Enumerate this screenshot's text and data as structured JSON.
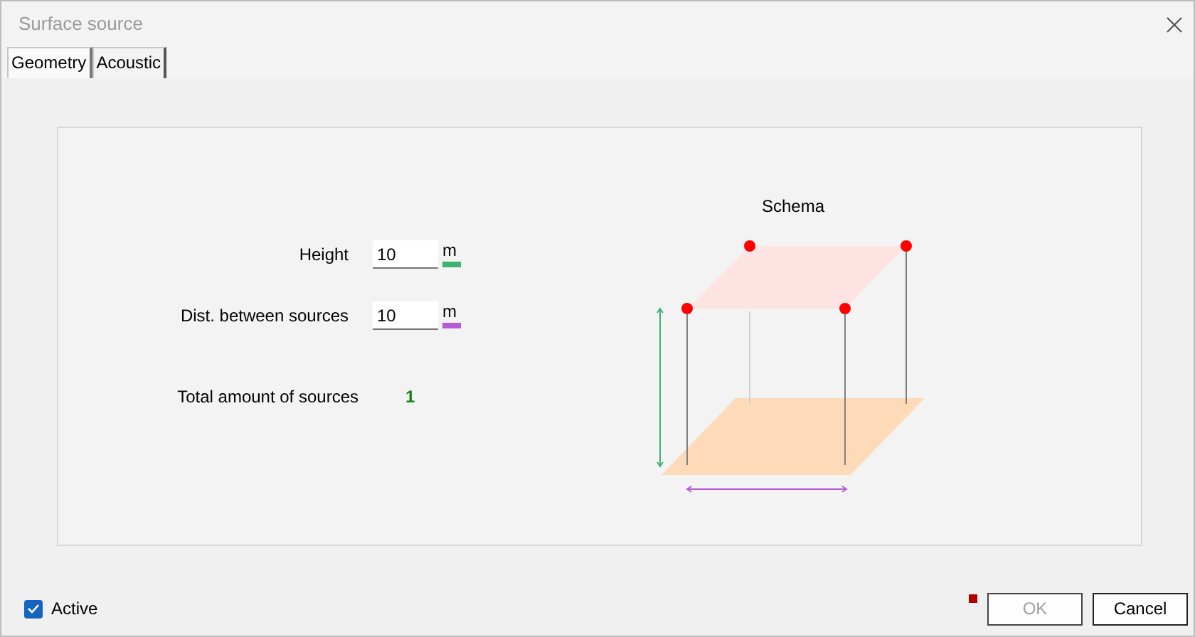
{
  "window": {
    "title": "Surface source"
  },
  "tabs": [
    {
      "label": "Geometry",
      "selected": true
    },
    {
      "label": "Acoustic",
      "selected": false
    }
  ],
  "fields": [
    {
      "label": "Height",
      "value": "10",
      "unit": "m",
      "color": "#3cb371"
    },
    {
      "label": "Dist. between sources",
      "value": "10",
      "unit": "m",
      "color": "#b65ad6"
    }
  ],
  "total": {
    "label": "Total amount of sources",
    "value": "1"
  },
  "schema": {
    "title": "Schema"
  },
  "active": {
    "label": "Active",
    "checked": true
  },
  "buttons": [
    {
      "label": "OK",
      "disabled": true
    },
    {
      "label": "Cancel",
      "disabled": false
    }
  ]
}
